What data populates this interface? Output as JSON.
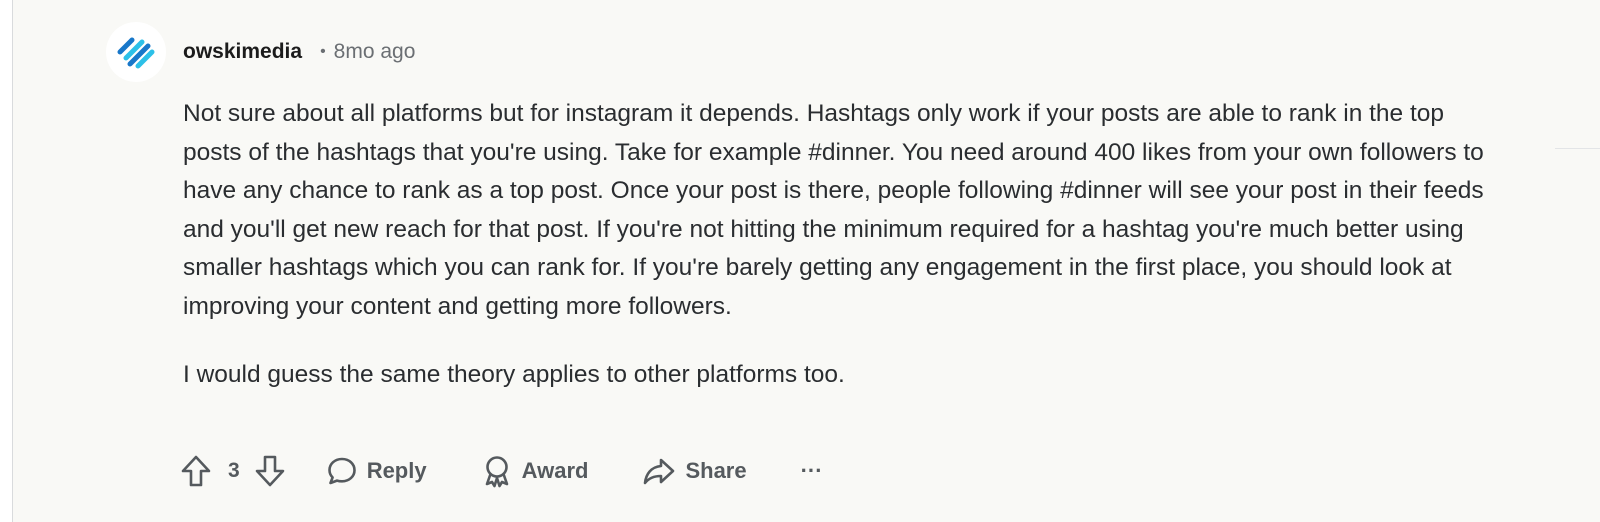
{
  "comment": {
    "username": "owskimedia",
    "separator": "•",
    "timestamp": "8mo ago",
    "paragraphs": [
      "Not sure about all platforms but for instagram it depends. Hashtags only work if your posts are able to rank in the top posts of the hashtags that you're using. Take for example #dinner. You need around 400 likes from your own followers to have any chance to rank as a top post. Once your post is there, people following #dinner will see your post in their feeds and you'll get new reach for that post. If you're not hitting the minimum required for a hashtag you're much better using smaller hashtags which you can rank for. If you're barely getting any engagement in the first place, you should look at improving your content and getting more followers.",
      "I would guess the same theory applies to other platforms too."
    ]
  },
  "actions": {
    "vote_count": "3",
    "reply_label": "Reply",
    "award_label": "Award",
    "share_label": "Share",
    "more_label": "···"
  },
  "icons": {
    "avatar": "striped-slash-logo-icon",
    "upvote": "arrow-up-outline-icon",
    "downvote": "arrow-down-outline-icon",
    "reply": "speech-bubble-icon",
    "award": "ribbon-award-icon",
    "share": "share-arrow-icon",
    "more": "ellipsis-icon"
  },
  "colors": {
    "background": "#f9f9f6",
    "text": "#2a2d30",
    "muted": "#6b6f73",
    "avatar_blue_dark": "#1877c9",
    "avatar_blue_light": "#2cc0e8"
  }
}
